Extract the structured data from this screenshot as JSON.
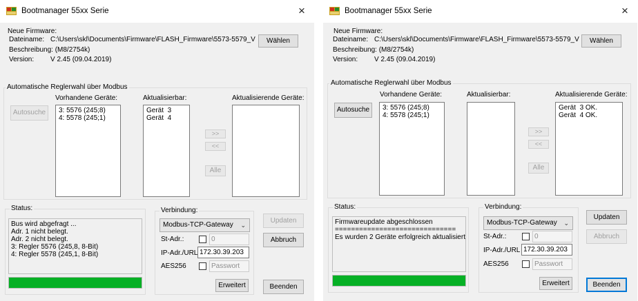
{
  "windows": [
    {
      "title": "Bootmanager 55xx Serie",
      "close_glyph": "×",
      "firmware": {
        "group_title": "Neue Firmware:",
        "dateiname_label": "Dateiname:",
        "dateiname_value": "C:\\Users\\skl\\Documents\\Firmware\\FLASH_Firmware\\5573-5579_V",
        "beschreibung": "Beschreibung: (M8/2754k)",
        "version_label": "Version:",
        "version_value": "V 2.45 (09.04.2019)",
        "waehlen_label": "Wählen"
      },
      "modbus": {
        "group_title": "Automatische Reglerwahl über Modbus",
        "autosuche_label": "Autosuche",
        "vorhandene_header": "Vorhandene Geräte:",
        "aktualisierbar_header": "Aktualisierbar:",
        "aktualisierende_header": "Aktualisierende Geräte:",
        "vorhandene_items": [
          "3: 5576 (245;8)",
          "4: 5578 (245;1)"
        ],
        "aktualisierbar_items": [
          "Gerät  3",
          "Gerät  4"
        ],
        "aktualisierende_items": [],
        "move_right_label": ">>",
        "move_left_label": "<<",
        "alle_label": "Alle"
      },
      "status": {
        "group_title": "Status:",
        "lines": [
          "",
          "Bus wird abgefragt ...",
          "Adr. 1 nicht belegt.",
          "Adr. 2 nicht belegt.",
          "3: Regler 5576 (245,8, 8-Bit)",
          "4: Regler 5578 (245,1, 8-Bit)"
        ],
        "progress_percent": 100
      },
      "verbindung": {
        "group_title": "Verbindung:",
        "mode_selected": "Modbus-TCP-Gateway",
        "st_adr_label": "St-Adr.:",
        "st_adr_value": "0",
        "ip_label": "IP-Adr./URL",
        "ip_value": "172.30.39.203",
        "aes_label": "AES256",
        "passwort_placeholder": "Passwort",
        "erweitert_label": "Erweitert"
      },
      "buttons": {
        "updaten_label": "Updaten",
        "abbruch_label": "Abbruch",
        "beenden_label": "Beenden"
      },
      "colors": {
        "progress": "#06b025"
      }
    },
    {
      "title": "Bootmanager 55xx Serie",
      "close_glyph": "×",
      "firmware": {
        "group_title": "Neue Firmware:",
        "dateiname_label": "Dateiname:",
        "dateiname_value": "C:\\Users\\skl\\Documents\\Firmware\\FLASH_Firmware\\5573-5579_V",
        "beschreibung": "Beschreibung: (M8/2754k)",
        "version_label": "Version:",
        "version_value": "V 2.45 (09.04.2019)",
        "waehlen_label": "Wählen"
      },
      "modbus": {
        "group_title": "Automatische Reglerwahl über Modbus",
        "autosuche_label": "Autosuche",
        "vorhandene_header": "Vorhandene Geräte:",
        "aktualisierbar_header": "Aktualisierbar:",
        "aktualisierende_header": "Aktualisierende Geräte:",
        "vorhandene_items": [
          "3: 5576 (245;8)",
          "4: 5578 (245;1)"
        ],
        "aktualisierbar_items": [],
        "aktualisierende_items": [
          "Gerät  3 OK.",
          "Gerät  4 OK."
        ],
        "move_right_label": ">>",
        "move_left_label": "<<",
        "alle_label": "Alle"
      },
      "status": {
        "group_title": "Status:",
        "lines": [
          "",
          "",
          "",
          "Firmwareupdate abgeschlossen",
          "==============================",
          "Es wurden 2 Geräte erfolgreich aktualisiert."
        ],
        "progress_percent": 100
      },
      "verbindung": {
        "group_title": "Verbindung:",
        "mode_selected": "Modbus-TCP-Gateway",
        "st_adr_label": "St-Adr.:",
        "st_adr_value": "0",
        "ip_label": "IP-Adr./URL",
        "ip_value": "172.30.39.203",
        "aes_label": "AES256",
        "passwort_placeholder": "Passwort",
        "erweitert_label": "Erweitert"
      },
      "buttons": {
        "updaten_label": "Updaten",
        "abbruch_label": "Abbruch",
        "beenden_label": "Beenden"
      },
      "colors": {
        "progress": "#06b025"
      }
    }
  ]
}
